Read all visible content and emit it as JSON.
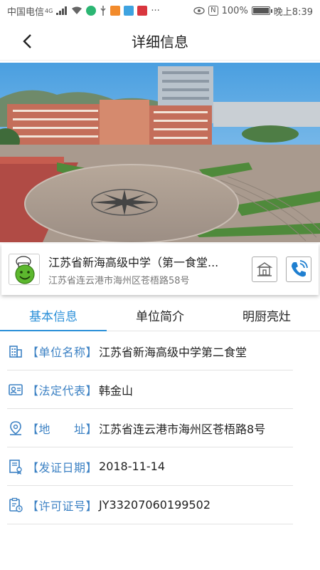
{
  "status_bar": {
    "carrier": "中国电信",
    "network": "4G",
    "battery": "100%",
    "battery_level": 1.0,
    "time": "晚上8:39"
  },
  "header": {
    "title": "详细信息"
  },
  "card": {
    "name": "江苏省新海高级中学（第一食堂...",
    "address": "江苏省连云港市海州区苍梧路58号"
  },
  "tabs": [
    {
      "label": "基本信息",
      "active": true
    },
    {
      "label": "单位简介",
      "active": false
    },
    {
      "label": "明厨亮灶",
      "active": false
    }
  ],
  "info": {
    "unit_name": {
      "label": "【单位名称】",
      "value": "江苏省新海高级中学第二食堂"
    },
    "legal_rep": {
      "label": "【法定代表】",
      "value": "韩金山"
    },
    "address": {
      "label": "【地　　址】",
      "value": "江苏省连云港市海州区苍梧路8号"
    },
    "issue_date": {
      "label": "【发证日期】",
      "value": "2018-11-14"
    },
    "license_no": {
      "label": "【许可证号】",
      "value": "JY33207060199502"
    }
  },
  "colors": {
    "accent": "#2a8fd8",
    "label": "#3d82c4"
  }
}
